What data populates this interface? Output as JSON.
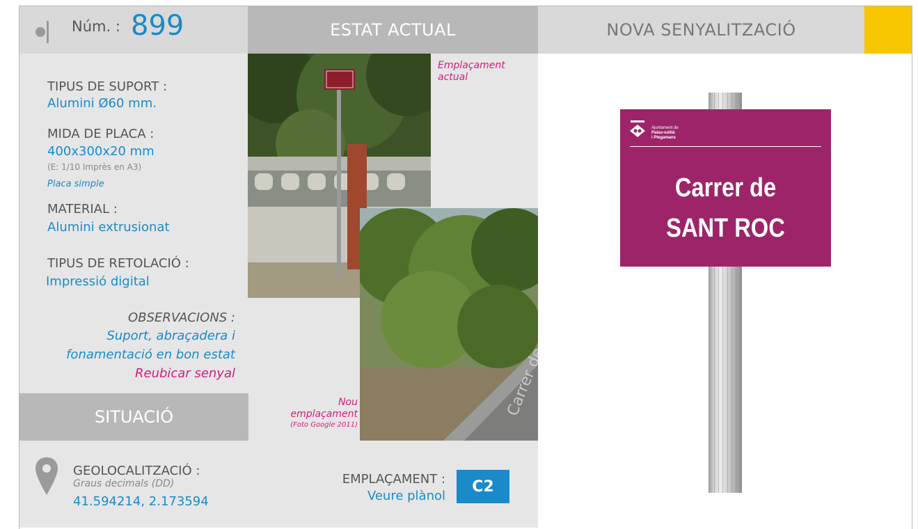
{
  "header": {
    "num_label": "Núm. :",
    "num_value": "899",
    "estat_actual": "ESTAT ACTUAL",
    "nova_senyalitzacio": "NOVA SENYALITZACIÓ"
  },
  "specs": {
    "tipus_suport_label": "TIPUS DE SUPORT :",
    "tipus_suport_value": "Alumini Ø60 mm.",
    "mida_placa_label": "MIDA DE PLACA :",
    "mida_placa_value": "400x300x20 mm",
    "mida_placa_note": "(E: 1/10 Imprès en A3)",
    "mida_placa_type": "Placa simple",
    "material_label": "MATERIAL :",
    "material_value": "Alumini extrusionat",
    "retolacio_label": "TIPUS DE RETOLACIÓ :",
    "retolacio_value": "Impressió digital",
    "observacions_label": "OBSERVACIONS :",
    "observacions_line1": "Suport, abraçadera i",
    "observacions_line2": "fonamentació en bon estat",
    "observacions_line3": "Reubicar senyal"
  },
  "situacio": {
    "title": "SITUACIÓ",
    "geo_label": "GEOLOCALITZACIÓ :",
    "geo_format": "Graus decimals (DD)",
    "geo_value": "41.594214, 2.173594",
    "emplacament_label": "EMPLAÇAMENT :",
    "emplacament_value": "Veure plànol",
    "emplacament_code": "C2"
  },
  "photos": {
    "actual_caption_1": "Emplaçament",
    "actual_caption_2": "actual",
    "nou_caption_1": "Nou",
    "nou_caption_2": "emplaçament",
    "nou_caption_3": "(Foto Google 2011)",
    "road_text": "Carrer de"
  },
  "sign": {
    "org_line1": "Ajuntament de",
    "org_line2": "Palau-solità",
    "org_line3": "i Plegamans",
    "text_line1": "Carrer de",
    "text_line2": "SANT ROC"
  },
  "colors": {
    "accent_blue": "#1a8ac8",
    "accent_pink": "#d21d7c",
    "sign_purple": "#9d2469",
    "header_yellow": "#f7c600"
  }
}
